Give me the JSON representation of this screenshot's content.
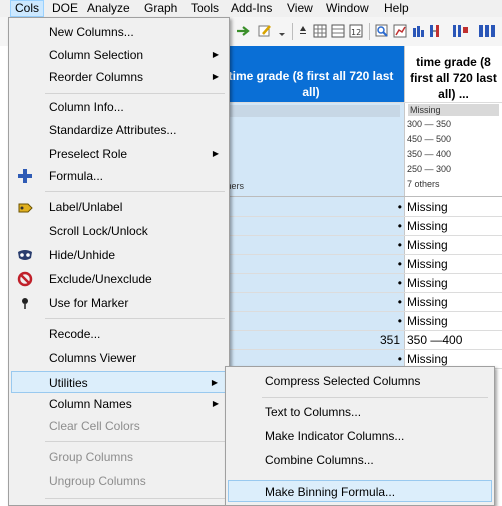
{
  "menubar": {
    "items": [
      "Cols",
      "DOE",
      "Analyze",
      "Graph",
      "Tools",
      "Add-Ins",
      "View",
      "Window",
      "Help"
    ],
    "active": "Cols"
  },
  "grid": {
    "columns": [
      {
        "header": "time grade (8 first all 720 last all)"
      },
      {
        "header": "time grade (8 first all 720 last all) ..."
      }
    ],
    "summary_left_footer": "thers",
    "summary_right": [
      "Missing",
      "300 — 350",
      "450 — 500",
      "350 — 400",
      "250 — 300",
      "7 others"
    ],
    "rows": [
      {
        "value": "•",
        "label": "Missing"
      },
      {
        "value": "•",
        "label": "Missing"
      },
      {
        "value": "•",
        "label": "Missing"
      },
      {
        "value": "•",
        "label": "Missing"
      },
      {
        "value": "•",
        "label": "Missing"
      },
      {
        "value": "•",
        "label": "Missing"
      },
      {
        "value": "•",
        "label": "Missing"
      },
      {
        "value": "351",
        "label": "350 —400"
      },
      {
        "value": "•",
        "label": "Missing"
      }
    ]
  },
  "cols_menu": {
    "items": [
      {
        "label": "New Columns...",
        "submenu": false,
        "icon": "",
        "disabled": false
      },
      {
        "label": "Column Selection",
        "submenu": true,
        "icon": "",
        "disabled": false
      },
      {
        "label": "Reorder Columns",
        "submenu": true,
        "icon": "",
        "disabled": false
      },
      {
        "label": "Column Info...",
        "submenu": false,
        "icon": "",
        "disabled": false
      },
      {
        "label": "Standardize Attributes...",
        "submenu": false,
        "icon": "",
        "disabled": false
      },
      {
        "label": "Preselect Role",
        "submenu": true,
        "icon": "",
        "disabled": false
      },
      {
        "label": "Formula...",
        "submenu": false,
        "icon": "formula-plus-icon",
        "disabled": false
      },
      {
        "label": "Label/Unlabel",
        "submenu": false,
        "icon": "label-tag-icon",
        "disabled": false
      },
      {
        "label": "Scroll Lock/Unlock",
        "submenu": false,
        "icon": "",
        "disabled": false
      },
      {
        "label": "Hide/Unhide",
        "submenu": false,
        "icon": "hide-mask-icon",
        "disabled": false
      },
      {
        "label": "Exclude/Unexclude",
        "submenu": false,
        "icon": "exclude-circle-icon",
        "disabled": false
      },
      {
        "label": "Use for Marker",
        "submenu": false,
        "icon": "marker-pin-icon",
        "disabled": false
      },
      {
        "label": "Recode...",
        "submenu": false,
        "icon": "",
        "disabled": false
      },
      {
        "label": "Columns Viewer",
        "submenu": false,
        "icon": "",
        "disabled": false
      },
      {
        "label": "Utilities",
        "submenu": true,
        "icon": "",
        "disabled": false
      },
      {
        "label": "Column Names",
        "submenu": true,
        "icon": "",
        "disabled": false
      },
      {
        "label": "Clear Cell Colors",
        "submenu": false,
        "icon": "",
        "disabled": true
      },
      {
        "label": "Group Columns",
        "submenu": false,
        "icon": "",
        "disabled": true
      },
      {
        "label": "Ungroup Columns",
        "submenu": false,
        "icon": "",
        "disabled": true
      }
    ]
  },
  "utilities_menu": {
    "items": [
      {
        "label": "Compress Selected Columns"
      },
      {
        "label": "Text to Columns..."
      },
      {
        "label": "Make Indicator Columns..."
      },
      {
        "label": "Combine Columns..."
      },
      {
        "label": "Make Binning Formula..."
      }
    ]
  },
  "colors": {
    "header_selected": "#0a6fd6",
    "column_selected": "#d3e7f7",
    "menu_bg": "#f0f0f0",
    "highlight": "#dceefb",
    "highlight_border": "#99c9ef"
  }
}
